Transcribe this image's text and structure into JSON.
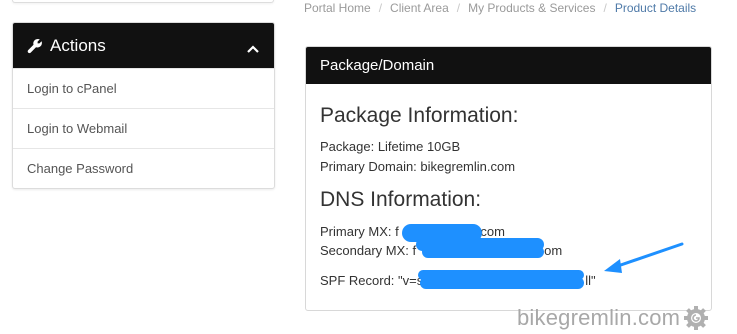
{
  "actions": {
    "title": "Actions",
    "items": [
      {
        "label": "Login to cPanel"
      },
      {
        "label": "Login to Webmail"
      },
      {
        "label": "Change Password"
      }
    ]
  },
  "breadcrumb": [
    {
      "label": "Portal Home"
    },
    {
      "label": "Client Area"
    },
    {
      "label": "My Products & Services"
    },
    {
      "label": "Product Details"
    }
  ],
  "package_panel": {
    "title": "Package/Domain",
    "package_heading": "Package Information:",
    "package_line": "Package: Lifetime 10GB",
    "domain_line": "Primary Domain: bikegremlin.com",
    "dns_heading": "DNS Information:",
    "primary_mx_label": "Primary MX: f",
    "primary_mx_tail": ".com",
    "secondary_mx_label": "Secondary MX: f",
    "secondary_mx_tail": "om",
    "spf_label": "SPF Record: \"v=s",
    "spf_tail": "ll\""
  },
  "watermark": {
    "text": "bikegremlin.com"
  },
  "colors": {
    "panel_header_bg": "#111111",
    "redaction": "#1e90ff",
    "annotation_arrow": "#1e90ff",
    "breadcrumb_active": "#4f7aa8"
  },
  "icons": {
    "actions_header": "wrench-icon",
    "actions_collapse": "chevron-up-icon",
    "watermark_logo": "gear-icon",
    "annotation": "arrow-icon"
  }
}
